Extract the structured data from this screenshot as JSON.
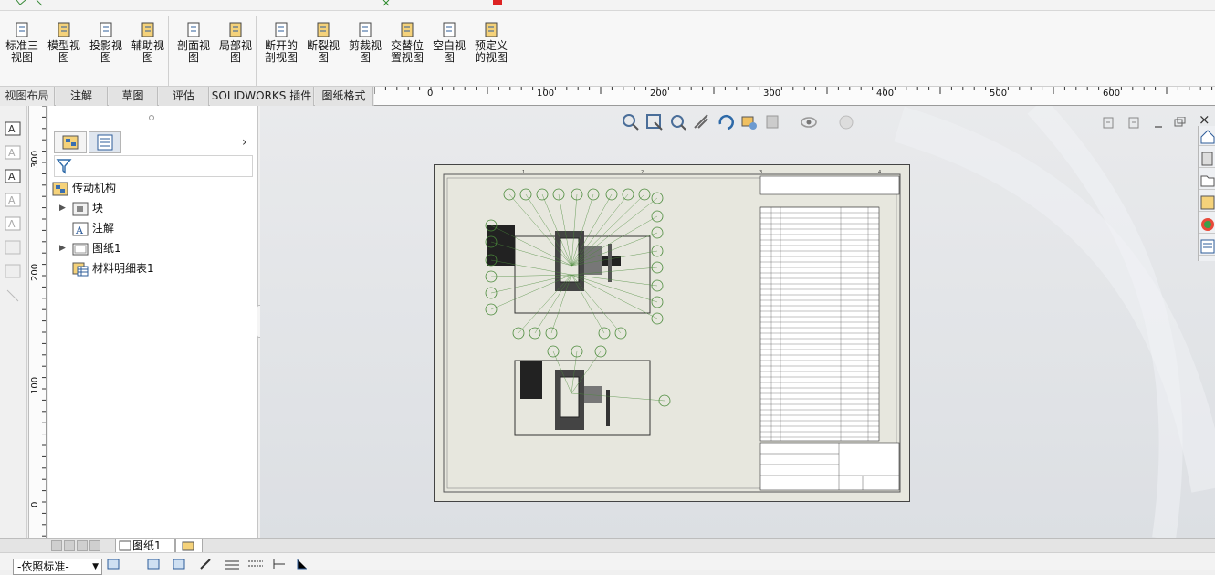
{
  "ribbon": {
    "groups": [
      {
        "items": [
          {
            "name": "standard-3-view-button",
            "icon": "standard-3-view-icon",
            "line1": "标准三",
            "line2": "视图"
          },
          {
            "name": "model-view-button",
            "icon": "model-view-icon",
            "line1": "模型视",
            "line2": "图"
          },
          {
            "name": "projected-view-button",
            "icon": "projected-view-icon",
            "line1": "投影视",
            "line2": "图"
          },
          {
            "name": "auxiliary-view-button",
            "icon": "auxiliary-view-icon",
            "line1": "辅助视",
            "line2": "图"
          }
        ]
      },
      {
        "items": [
          {
            "name": "section-view-button",
            "icon": "section-view-icon",
            "line1": "剖面视",
            "line2": "图"
          },
          {
            "name": "detail-view-button",
            "icon": "detail-view-icon",
            "line1": "局部视",
            "line2": "图"
          }
        ]
      },
      {
        "items": [
          {
            "name": "broken-out-section-button",
            "icon": "broken-out-section-icon",
            "line1": "断开的",
            "line2": "剖视图"
          },
          {
            "name": "break-view-button",
            "icon": "break-view-icon",
            "line1": "断裂视",
            "line2": "图"
          },
          {
            "name": "crop-view-button",
            "icon": "crop-view-icon",
            "line1": "剪裁视",
            "line2": "图"
          },
          {
            "name": "alternate-position-view-button",
            "icon": "alternate-position-icon",
            "line1": "交替位",
            "line2": "置视图"
          },
          {
            "name": "empty-view-button",
            "icon": "empty-view-icon",
            "line1": "空白视",
            "line2": "图"
          },
          {
            "name": "predefined-view-button",
            "icon": "predefined-view-icon",
            "line1": "预定义",
            "line2": "的视图"
          }
        ]
      }
    ]
  },
  "tabs": [
    "视图布局",
    "注解",
    "草图",
    "评估",
    "SOLIDWORKS 插件",
    "图纸格式"
  ],
  "hruler": [
    "0",
    "100",
    "200",
    "300",
    "400",
    "500",
    "600"
  ],
  "vruler": [
    "300",
    "200",
    "100",
    "0"
  ],
  "tree": {
    "root": "传动机构",
    "items": [
      "块",
      "注解",
      "图纸1",
      "材料明细表1"
    ]
  },
  "sheet_tabs": [
    "图纸1"
  ],
  "layer": {
    "value": "-依照标准-"
  },
  "colors": {
    "sheet_bg": "#e7e7de",
    "balloon": "#4a8a3a",
    "canvas": "#e3e5e8"
  }
}
